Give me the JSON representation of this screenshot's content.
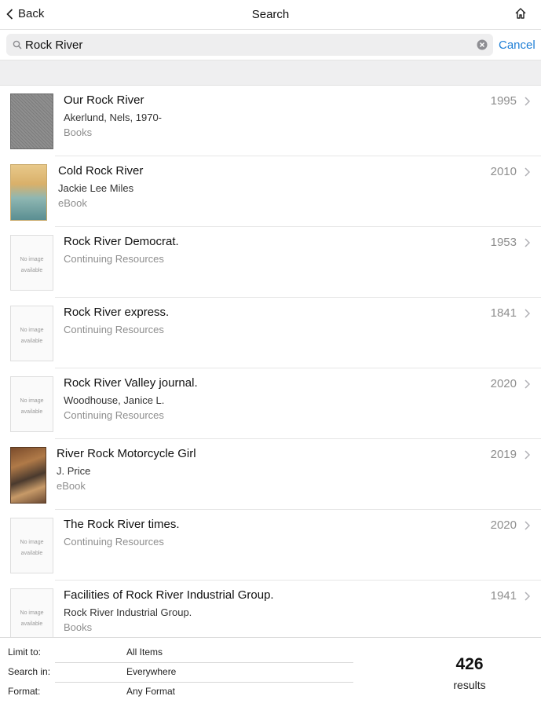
{
  "nav": {
    "back_label": "Back",
    "title": "Search",
    "home_icon": "home-icon"
  },
  "search": {
    "value": "Rock River",
    "cancel_label": "Cancel"
  },
  "results": [
    {
      "title": "Our Rock River",
      "author": "Akerlund, Nels, 1970-",
      "format": "Books",
      "year": "1995",
      "thumb": "cover"
    },
    {
      "title": "Cold Rock River",
      "author": "Jackie Lee Miles",
      "format": "eBook",
      "year": "2010",
      "thumb": "cover"
    },
    {
      "title": "Rock River Democrat.",
      "author": "",
      "format": "Continuing Resources",
      "year": "1953",
      "thumb": "No image available"
    },
    {
      "title": "Rock River express.",
      "author": "",
      "format": "Continuing Resources",
      "year": "1841",
      "thumb": "No image available"
    },
    {
      "title": "Rock River Valley journal.",
      "author": "Woodhouse, Janice L.",
      "format": "Continuing Resources",
      "year": "2020",
      "thumb": "No image available"
    },
    {
      "title": "River Rock Motorcycle Girl",
      "author": "J. Price",
      "format": "eBook",
      "year": "2019",
      "thumb": "cover"
    },
    {
      "title": "The Rock River times.",
      "author": "",
      "format": "Continuing Resources",
      "year": "2020",
      "thumb": "No image available"
    },
    {
      "title": "Facilities of Rock River Industrial Group.",
      "author": "Rock River Industrial Group.",
      "format": "Books",
      "year": "1941",
      "thumb": "No image available"
    }
  ],
  "noimage": {
    "line1": "No image",
    "line2": "available"
  },
  "filters": {
    "limit_label": "Limit to:",
    "limit_value": "All Items",
    "search_label": "Search in:",
    "search_value": "Everywhere",
    "format_label": "Format:",
    "format_value": "Any Format"
  },
  "summary": {
    "count": "426",
    "label": "results"
  }
}
